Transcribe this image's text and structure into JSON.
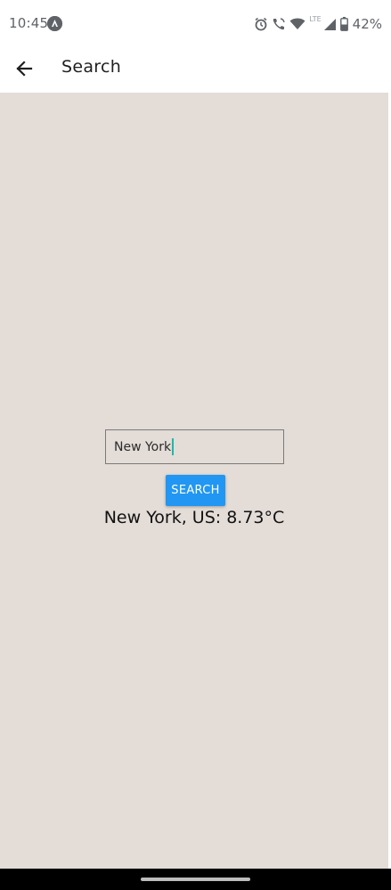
{
  "status_bar": {
    "time": "10:45",
    "lte": "LTE",
    "battery_percent": "42%",
    "icons": [
      "app-notification-icon",
      "alarm-icon",
      "wifi-calling-icon",
      "wifi-icon",
      "cell-signal-icon",
      "battery-icon"
    ]
  },
  "app_bar": {
    "title": "Search",
    "back_icon": "arrow-left-icon"
  },
  "search": {
    "input_value": "New York",
    "button_label": "SEARCH"
  },
  "result": {
    "text": "New York, US: 8.73°C"
  },
  "colors": {
    "content_background": "#e3dcd7",
    "button_background": "#2196f3",
    "button_text": "#ffffff",
    "caret": "#1fb8a5",
    "nav_bar": "#000000"
  }
}
